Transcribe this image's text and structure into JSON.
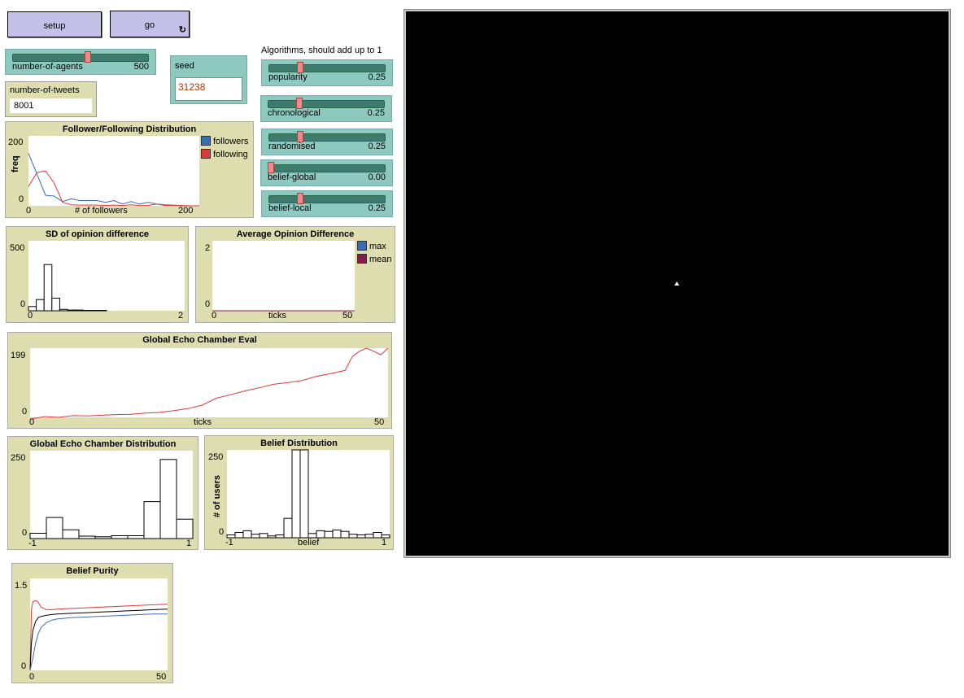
{
  "buttons": {
    "setup": "setup",
    "go": "go"
  },
  "forever_icon": "forever-icon",
  "sliders": {
    "agents": {
      "label": "number-of-agents",
      "value": "500",
      "fraction": 0.55
    },
    "popularity": {
      "label": "popularity",
      "value": "0.25",
      "fraction": 0.25
    },
    "chronological": {
      "label": "chronological",
      "value": "0.25",
      "fraction": 0.25
    },
    "randomised": {
      "label": "randomised",
      "value": "0.25",
      "fraction": 0.25
    },
    "belief_global": {
      "label": "belief-global",
      "value": "0.00",
      "fraction": 0.0
    },
    "belief_local": {
      "label": "belief-local",
      "value": "0.25",
      "fraction": 0.25
    }
  },
  "monitor_tweets": {
    "label": "number-of-tweets",
    "value": "8001"
  },
  "seed": {
    "label": "seed",
    "value": "31238"
  },
  "algorithms_note": "Algorithms, should add up to 1",
  "colors": {
    "blue": "#3a6bb5",
    "red": "#d93a3a",
    "maroon": "#8b1a4a",
    "black": "#000000"
  },
  "plots": {
    "follower": {
      "title": "Follower/Following Distribution",
      "xlabel": "# of followers",
      "ylabel": "freq",
      "xmin": "0",
      "xmax": "200",
      "ymin": "0",
      "ymax": "200",
      "legend": [
        "followers",
        "following"
      ]
    },
    "sd": {
      "title": "SD of opinion difference",
      "xmin": "0",
      "xmax": "2",
      "ymin": "0",
      "ymax": "500"
    },
    "avg": {
      "title": "Average Opinion Difference",
      "xlabel": "ticks",
      "xmin": "0",
      "xmax": "50",
      "ymin": "0",
      "ymax": "2",
      "legend": [
        "max",
        "mean"
      ]
    },
    "echo_eval": {
      "title": "Global Echo Chamber Eval",
      "xlabel": "ticks",
      "xmin": "0",
      "xmax": "50",
      "ymin": "0",
      "ymax": "199"
    },
    "echo_dist": {
      "title": "Global Echo Chamber Distribution",
      "xmin": "-1",
      "xmax": "1",
      "ymin": "0",
      "ymax": "250"
    },
    "belief_dist": {
      "title": "Belief Distribution",
      "xlabel": "belief",
      "ylabel": "# of users",
      "xmin": "-1",
      "xmax": "1",
      "ymin": "0",
      "ymax": "250"
    },
    "purity": {
      "title": "Belief Purity",
      "xmin": "0",
      "xmax": "50",
      "ymin": "0",
      "ymax": "1.5"
    }
  },
  "chart_data": [
    {
      "type": "line",
      "title": "Follower/Following Distribution",
      "xlabel": "# of followers",
      "ylabel": "freq",
      "xlim": [
        0,
        200
      ],
      "ylim": [
        0,
        200
      ],
      "series": [
        {
          "name": "followers",
          "color": "#3a6bb5",
          "x": [
            0,
            10,
            20,
            30,
            40,
            50,
            60,
            70,
            80,
            90,
            100,
            110,
            120,
            130,
            140,
            150,
            160,
            170,
            180,
            190,
            200
          ],
          "values": [
            150,
            90,
            30,
            28,
            12,
            20,
            15,
            15,
            15,
            10,
            15,
            5,
            12,
            5,
            10,
            5,
            3,
            2,
            0,
            0,
            0
          ]
        },
        {
          "name": "following",
          "color": "#d93a3a",
          "x": [
            0,
            10,
            20,
            30,
            40,
            50,
            60,
            70,
            80,
            90,
            100,
            110,
            120,
            130,
            140,
            150,
            160,
            170,
            180,
            190,
            200
          ],
          "values": [
            55,
            95,
            100,
            65,
            10,
            3,
            2,
            2,
            2,
            1,
            2,
            1,
            3,
            1,
            1,
            5,
            1,
            1,
            1,
            0,
            0
          ]
        }
      ]
    },
    {
      "type": "bar",
      "title": "SD of opinion difference",
      "xlim": [
        0,
        2
      ],
      "ylim": [
        0,
        500
      ],
      "bins": [
        0,
        0.1,
        0.2,
        0.3,
        0.4,
        0.5,
        0.6,
        0.7,
        0.8,
        0.9,
        1.0
      ],
      "values": [
        30,
        80,
        330,
        90,
        10,
        5,
        5,
        3,
        3,
        3
      ]
    },
    {
      "type": "line",
      "title": "Average Opinion Difference",
      "xlabel": "ticks",
      "xlim": [
        0,
        50
      ],
      "ylim": [
        0,
        2
      ],
      "series": [
        {
          "name": "max",
          "color": "#3a6bb5",
          "x": [
            0,
            50
          ],
          "values": [
            0,
            0
          ]
        },
        {
          "name": "mean",
          "color": "#8b1a4a",
          "x": [
            0,
            50
          ],
          "values": [
            0,
            0
          ]
        }
      ]
    },
    {
      "type": "line",
      "title": "Global Echo Chamber Eval",
      "xlabel": "ticks",
      "xlim": [
        0,
        50
      ],
      "ylim": [
        0,
        199
      ],
      "series": [
        {
          "color": "#d93a3a",
          "x": [
            0,
            2,
            4,
            6,
            8,
            10,
            12,
            14,
            16,
            18,
            20,
            22,
            24,
            26,
            28,
            30,
            32,
            34,
            36,
            38,
            40,
            42,
            44,
            45,
            46,
            47,
            48,
            49,
            50
          ],
          "values": [
            -5,
            2,
            0,
            5,
            4,
            6,
            8,
            9,
            12,
            14,
            19,
            25,
            35,
            55,
            65,
            76,
            85,
            95,
            100,
            106,
            118,
            126,
            135,
            175,
            190,
            199,
            190,
            180,
            199
          ]
        }
      ]
    },
    {
      "type": "bar",
      "title": "Global Echo Chamber Distribution",
      "xlim": [
        -1,
        1
      ],
      "ylim": [
        0,
        250
      ],
      "bins": [
        -1,
        -0.8,
        -0.6,
        -0.4,
        -0.2,
        0,
        0.2,
        0.4,
        0.6,
        0.8,
        1.0
      ],
      "values": [
        15,
        60,
        25,
        7,
        5,
        8,
        8,
        105,
        225,
        55
      ]
    },
    {
      "type": "bar",
      "title": "Belief Distribution",
      "xlabel": "belief",
      "ylabel": "# of users",
      "xlim": [
        -1,
        1
      ],
      "ylim": [
        0,
        250
      ],
      "bins": [
        -1,
        -0.9,
        -0.8,
        -0.7,
        -0.6,
        -0.5,
        -0.4,
        -0.3,
        -0.2,
        -0.1,
        0,
        0.1,
        0.2,
        0.3,
        0.4,
        0.5,
        0.6,
        0.7,
        0.8,
        0.9,
        1.0
      ],
      "values": [
        8,
        15,
        20,
        10,
        12,
        5,
        8,
        55,
        250,
        250,
        12,
        20,
        18,
        22,
        18,
        10,
        8,
        10,
        15,
        8
      ]
    },
    {
      "type": "line",
      "title": "Belief Purity",
      "xlim": [
        0,
        50
      ],
      "ylim": [
        0,
        1.5
      ],
      "series": [
        {
          "color": "#d93a3a",
          "x": [
            0,
            0.5,
            1,
            2,
            3,
            4,
            6,
            8,
            10,
            15,
            20,
            25,
            30,
            35,
            40,
            45,
            50
          ],
          "values": [
            0.05,
            1.0,
            1.12,
            1.14,
            1.11,
            1.03,
            0.99,
            0.99,
            1.0,
            1.01,
            1.02,
            1.03,
            1.04,
            1.05,
            1.06,
            1.07,
            1.08
          ]
        },
        {
          "color": "#000000",
          "x": [
            0,
            0.5,
            1,
            2,
            3,
            4,
            6,
            8,
            10,
            15,
            20,
            25,
            30,
            35,
            40,
            45,
            50
          ],
          "values": [
            0,
            0.45,
            0.65,
            0.8,
            0.86,
            0.88,
            0.9,
            0.91,
            0.92,
            0.93,
            0.94,
            0.95,
            0.96,
            0.97,
            0.98,
            0.99,
            1.0
          ]
        },
        {
          "color": "#3a6bb5",
          "x": [
            0,
            1,
            2,
            3,
            4,
            6,
            8,
            10,
            15,
            20,
            25,
            30,
            35,
            40,
            45,
            50
          ],
          "values": [
            0,
            0.2,
            0.45,
            0.6,
            0.7,
            0.78,
            0.82,
            0.84,
            0.86,
            0.87,
            0.88,
            0.89,
            0.9,
            0.91,
            0.92,
            0.92
          ]
        }
      ]
    }
  ]
}
